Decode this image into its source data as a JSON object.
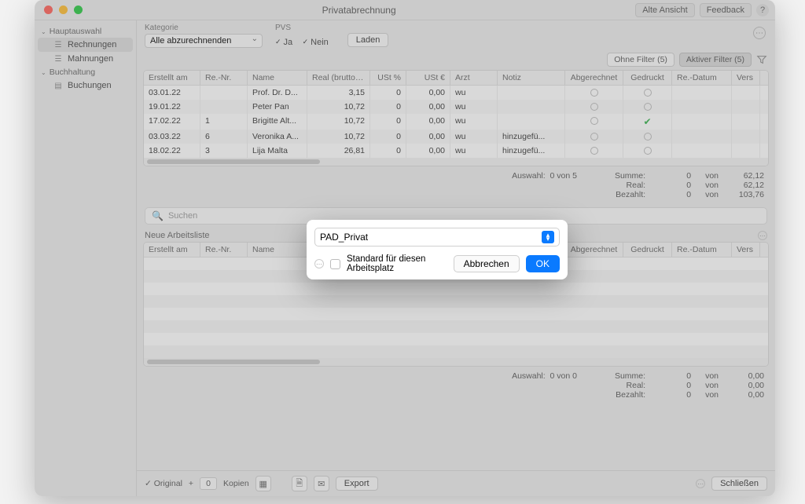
{
  "window": {
    "title": "Privatabrechnung",
    "buttons": {
      "old_view": "Alte Ansicht",
      "feedback": "Feedback"
    }
  },
  "sidebar": {
    "group1": {
      "label": "Hauptauswahl",
      "items": [
        {
          "label": "Rechnungen",
          "selected": true
        },
        {
          "label": "Mahnungen",
          "selected": false
        }
      ]
    },
    "group2": {
      "label": "Buchhaltung",
      "items": [
        {
          "label": "Buchungen",
          "selected": false
        }
      ]
    }
  },
  "toolbar": {
    "category_label": "Kategorie",
    "category_value": "Alle abzurechnenden",
    "pvs_label": "PVS",
    "pvs_ja": "Ja",
    "pvs_nein": "Nein",
    "load": "Laden"
  },
  "filters": {
    "no_filter": "Ohne Filter (5)",
    "active_filter": "Aktiver Filter (5)"
  },
  "columns": {
    "erstellt": "Erstellt am",
    "renr": "Re.-Nr.",
    "name": "Name",
    "real": "Real (brutto) €",
    "ustp": "USt %",
    "ust": "USt €",
    "arzt": "Arzt",
    "notiz": "Notiz",
    "abg": "Abgerechnet",
    "ged": "Gedruckt",
    "redat": "Re.-Datum",
    "vers": "Vers"
  },
  "rows": [
    {
      "erstellt": "03.01.22",
      "renr": "",
      "name": "Prof. Dr. D...",
      "real": "3,15",
      "ustp": "0",
      "ust": "0,00",
      "arzt": "wu",
      "notiz": "",
      "ged": false
    },
    {
      "erstellt": "19.01.22",
      "renr": "",
      "name": "Peter Pan",
      "real": "10,72",
      "ustp": "0",
      "ust": "0,00",
      "arzt": "wu",
      "notiz": "",
      "ged": false
    },
    {
      "erstellt": "17.02.22",
      "renr": "1",
      "name": "Brigitte Alt...",
      "real": "10,72",
      "ustp": "0",
      "ust": "0,00",
      "arzt": "wu",
      "notiz": "",
      "ged": true
    },
    {
      "erstellt": "03.03.22",
      "renr": "6",
      "name": "Veronika A...",
      "real": "10,72",
      "ustp": "0",
      "ust": "0,00",
      "arzt": "wu",
      "notiz": "hinzugefü...",
      "ged": false
    },
    {
      "erstellt": "18.02.22",
      "renr": "3",
      "name": "Lija Malta",
      "real": "26,81",
      "ustp": "0",
      "ust": "0,00",
      "arzt": "wu",
      "notiz": "hinzugefü...",
      "ged": false
    }
  ],
  "summary1": {
    "selection_label": "Auswahl:",
    "selection_value": "0 von 5",
    "lines": [
      {
        "label": "Summe:",
        "v1": "0",
        "mid": "von",
        "v2": "62,12"
      },
      {
        "label": "Real:",
        "v1": "0",
        "mid": "von",
        "v2": "62,12"
      },
      {
        "label": "Bezahlt:",
        "v1": "0",
        "mid": "von",
        "v2": "103,76"
      }
    ]
  },
  "search_placeholder": "Suchen",
  "section2_title": "Neue Arbeitsliste",
  "summary2": {
    "selection_label": "Auswahl:",
    "selection_value": "0 von 0",
    "lines": [
      {
        "label": "Summe:",
        "v1": "0",
        "mid": "von",
        "v2": "0,00"
      },
      {
        "label": "Real:",
        "v1": "0",
        "mid": "von",
        "v2": "0,00"
      },
      {
        "label": "Bezahlt:",
        "v1": "0",
        "mid": "von",
        "v2": "0,00"
      }
    ]
  },
  "footer": {
    "original": "Original",
    "plus": "+",
    "copies_count": "0",
    "copies_label": "Kopien",
    "export": "Export",
    "close": "Schließen"
  },
  "modal": {
    "value": "PAD_Privat",
    "checkbox_label": "Standard für diesen Arbeitsplatz",
    "cancel": "Abbrechen",
    "ok": "OK"
  }
}
